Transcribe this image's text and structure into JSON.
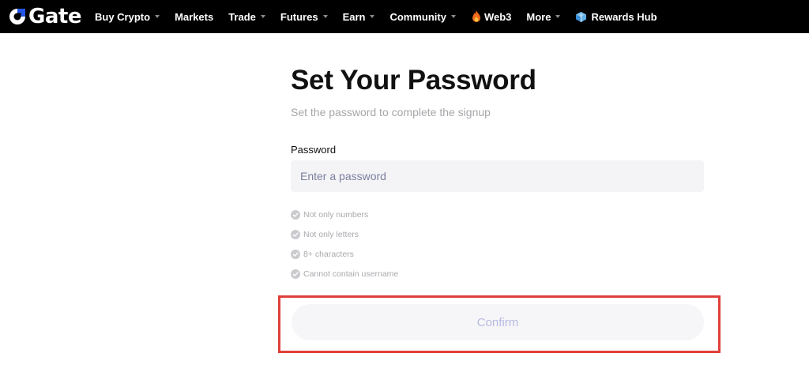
{
  "brand": {
    "name": "Gate",
    "accent_color": "#2354e6",
    "logo_icon": "gate-logo-icon"
  },
  "nav": {
    "items": [
      {
        "label": "Buy Crypto",
        "dropdown": true
      },
      {
        "label": "Markets",
        "dropdown": false
      },
      {
        "label": "Trade",
        "dropdown": true
      },
      {
        "label": "Futures",
        "dropdown": true
      },
      {
        "label": "Earn",
        "dropdown": true
      },
      {
        "label": "Community",
        "dropdown": true
      },
      {
        "label": "Web3",
        "dropdown": false,
        "icon": "fire-icon"
      },
      {
        "label": "More",
        "dropdown": true
      },
      {
        "label": "Rewards Hub",
        "dropdown": false,
        "icon": "gift-icon"
      }
    ]
  },
  "form": {
    "title": "Set Your Password",
    "subtitle": "Set the password to complete the signup",
    "password_label": "Password",
    "password_placeholder": "Enter a password",
    "password_value": "",
    "rules": [
      {
        "text": "Not only numbers",
        "icon": "check-circle-icon"
      },
      {
        "text": "Not only letters",
        "icon": "check-circle-icon"
      },
      {
        "text": "8+ characters",
        "icon": "check-circle-icon"
      },
      {
        "text": "Cannot contain username",
        "icon": "check-circle-icon"
      }
    ],
    "confirm_label": "Confirm",
    "confirm_enabled": false
  },
  "annotation": {
    "highlight_color": "#e0403a",
    "highlights": "confirm-button"
  }
}
